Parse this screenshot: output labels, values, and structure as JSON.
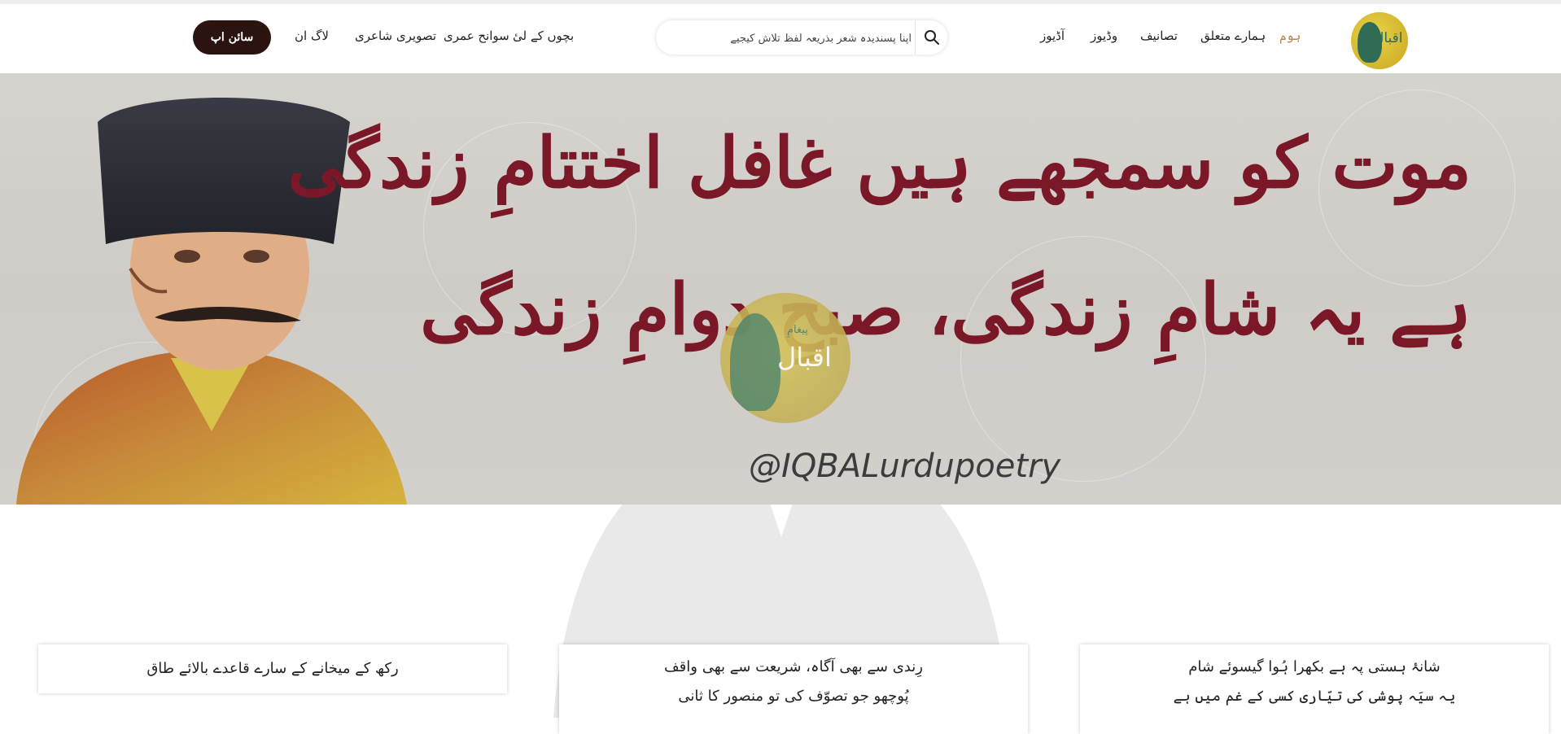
{
  "header": {
    "logo_icon": "iqbal-logo-icon",
    "logo_text": "اقبال",
    "nav": {
      "home": "ہوم",
      "about": "ہمارے متعلق",
      "works": "تصانیف",
      "videos": "وڈیوز",
      "audios": "آڈیوز",
      "children": "بچوں کے لیٔ",
      "biography": "سوانح عمری",
      "picture_poetry": "تصویری شاعری",
      "login": "لاگ ان"
    },
    "search": {
      "placeholder": "اپنا پسندیدہ شعر بذریعہ لفظ تلاش کیجیے",
      "icon": "search-icon"
    },
    "signup_label": "سائن اپ"
  },
  "hero": {
    "verse_line_1": "موت کو سمجھے ہیں غافل اختتامِ زندگی",
    "verse_line_2": "ہے یہ شامِ زندگی، صبحِ دوامِ زندگی",
    "handle": "@IQBALurdupoetry",
    "watermark_small": "پیغامِ",
    "watermark_text": "اقبال"
  },
  "cards": [
    {
      "lines": [
        "رکھ کے میخانے کے سارے قاعدے بالائے طاق"
      ]
    },
    {
      "lines": [
        "رِندی سے بھی آگاہ، شریعت سے بھی واقف",
        "پُوچھو جو تصوّف کی تو منصور کا ثانی"
      ]
    },
    {
      "lines": [
        "شانۂ ہستی پہ ہے بکھرا ہُوا گیسوئے شام",
        "یہ سیَہ پوشی کی تیّاری کسی کے غم میں ہے"
      ]
    }
  ],
  "colors": {
    "accent": "#b9854a",
    "signup_bg": "#2b1410",
    "verse": "#7a1828"
  }
}
